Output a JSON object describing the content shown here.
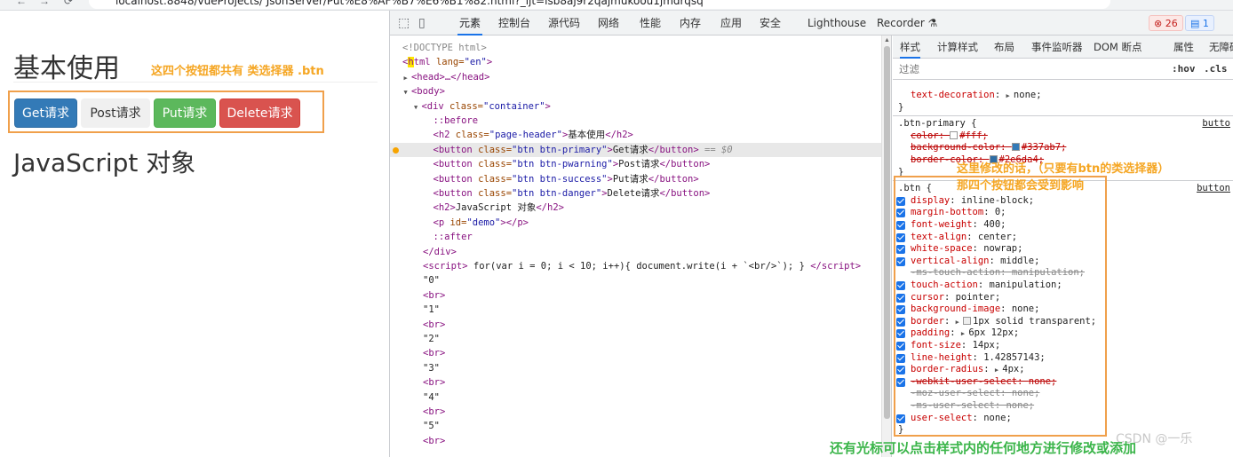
{
  "browser": {
    "url": "localhost:8848/vueProjects/ JsonServer/Put%E8%AF%B7%E6%B1%82.html?_ijt=lsb8aj9r2qajmukoou1jmdrqsq",
    "nav_back": "←",
    "nav_forward": "→",
    "nav_reload": "⟳"
  },
  "page": {
    "title": "基本使用",
    "buttons": [
      {
        "label": "Get请求",
        "class": "btn btn-primary"
      },
      {
        "label": "Post请求",
        "class": "btn btn-pwarning"
      },
      {
        "label": "Put请求",
        "class": "btn btn-success"
      },
      {
        "label": "Delete请求",
        "class": "btn btn-danger"
      }
    ],
    "js_title": "JavaScript 对象"
  },
  "devtools": {
    "tabs": [
      "元素",
      "控制台",
      "源代码",
      "网络",
      "性能",
      "内存",
      "应用",
      "安全",
      "Lighthouse",
      "Recorder ⚗"
    ],
    "active_tab": "元素",
    "error_count": "26",
    "message_count": "1",
    "elements": [
      {
        "indent": 0,
        "html": "<!DOCTYPE html>",
        "kind": "comment"
      },
      {
        "indent": 0,
        "tag": "html",
        "attrs": [
          [
            "lang",
            "en"
          ]
        ],
        "open": true
      },
      {
        "indent": 1,
        "collapsed": "<head>…</head>"
      },
      {
        "indent": 1,
        "tag": "body",
        "arrow": "▼"
      },
      {
        "indent": 2,
        "tag": "div",
        "attrs": [
          [
            "class",
            "container"
          ]
        ],
        "arrow": "▼"
      },
      {
        "indent": 3,
        "pseudo": "::before"
      },
      {
        "indent": 3,
        "tag": "h2",
        "attrs": [
          [
            "class",
            "page-header"
          ]
        ],
        "text": "基本使用",
        "close": "h2"
      },
      {
        "indent": 3,
        "tag": "button",
        "attrs": [
          [
            "class",
            "btn btn-primary"
          ]
        ],
        "text": "Get请求",
        "close": "button",
        "suffix": " == $0",
        "selected": true
      },
      {
        "indent": 3,
        "tag": "button",
        "attrs": [
          [
            "class",
            "btn btn-pwarning"
          ]
        ],
        "text": "Post请求",
        "close": "button"
      },
      {
        "indent": 3,
        "tag": "button",
        "attrs": [
          [
            "class",
            "btn btn-success"
          ]
        ],
        "text": "Put请求",
        "close": "button"
      },
      {
        "indent": 3,
        "tag": "button",
        "attrs": [
          [
            "class",
            "btn btn-danger"
          ]
        ],
        "text": "Delete请求",
        "close": "button"
      },
      {
        "indent": 3,
        "tag": "h2",
        "text": "JavaScript 对象",
        "close": "h2"
      },
      {
        "indent": 3,
        "tag": "p",
        "attrs": [
          [
            "id",
            "demo"
          ]
        ],
        "close": "p"
      },
      {
        "indent": 3,
        "pseudo": "::after"
      },
      {
        "indent": 2,
        "endtag": "div"
      },
      {
        "indent": 2,
        "tag": "script",
        "text": " for(var i = 0; i < 10; i++){ document.write(i + `<br/>`); } ",
        "close": "script"
      },
      {
        "indent": 2,
        "string": "\"0\""
      },
      {
        "indent": 2,
        "tag": "br"
      },
      {
        "indent": 2,
        "string": "\"1\""
      },
      {
        "indent": 2,
        "tag": "br"
      },
      {
        "indent": 2,
        "string": "\"2\""
      },
      {
        "indent": 2,
        "tag": "br"
      },
      {
        "indent": 2,
        "string": "\"3\""
      },
      {
        "indent": 2,
        "tag": "br"
      },
      {
        "indent": 2,
        "string": "\"4\""
      },
      {
        "indent": 2,
        "tag": "br"
      },
      {
        "indent": 2,
        "string": "\"5\""
      },
      {
        "indent": 2,
        "tag": "br"
      }
    ],
    "styles_tabs": [
      "样式",
      "计算样式",
      "布局",
      "事件监听器",
      "DOM 断点",
      "属性",
      "无障碍"
    ],
    "filter_placeholder": "过滤",
    "hov": ":hov",
    "cls": ".cls",
    "rules": {
      "top_line": {
        "name": "text-decoration",
        "value": "none;"
      },
      "btn_primary": {
        "selector": ".btn-primary {",
        "source": "butto",
        "props": [
          {
            "name": "color",
            "value": "#fff;",
            "swatch": "#ffffff"
          },
          {
            "name": "background-color",
            "value": "#337ab7;",
            "swatch": "#337ab7"
          },
          {
            "name": "border-color",
            "value": "#2e6da4;",
            "swatch": "#2e6da4"
          }
        ]
      },
      "btn": {
        "selector": ".btn {",
        "source": "button",
        "props": [
          {
            "name": "display",
            "value": "inline-block;",
            "checked": true
          },
          {
            "name": "margin-bottom",
            "value": "0;",
            "checked": true
          },
          {
            "name": "font-weight",
            "value": "400;",
            "checked": true
          },
          {
            "name": "text-align",
            "value": "center;",
            "checked": true
          },
          {
            "name": "white-space",
            "value": "nowrap;",
            "checked": true
          },
          {
            "name": "vertical-align",
            "value": "middle;",
            "checked": true
          },
          {
            "name": "-ms-touch-action",
            "value": "manipulation;",
            "checked": false,
            "strike": true
          },
          {
            "name": "touch-action",
            "value": "manipulation;",
            "checked": true
          },
          {
            "name": "cursor",
            "value": "pointer;",
            "checked": true
          },
          {
            "name": "background-image",
            "value": "none;",
            "checked": true
          },
          {
            "name": "border",
            "value": "1px solid transparent;",
            "checked": true,
            "arrow": true,
            "swatch": "#eeeeee"
          },
          {
            "name": "padding",
            "value": "6px 12px;",
            "checked": true,
            "arrow": true
          },
          {
            "name": "font-size",
            "value": "14px;",
            "checked": true
          },
          {
            "name": "line-height",
            "value": "1.42857143;",
            "checked": true
          },
          {
            "name": "border-radius",
            "value": "4px;",
            "checked": true,
            "arrow": true
          },
          {
            "name": "-webkit-user-select",
            "value": "none;",
            "checked": true,
            "strike_red": true
          },
          {
            "name": "-moz-user-select",
            "value": "none;",
            "checked": false,
            "strike": true
          },
          {
            "name": "-ms-user-select",
            "value": "none;",
            "checked": false,
            "strike": true
          },
          {
            "name": "user-select",
            "value": "none;",
            "checked": true
          }
        ]
      }
    }
  },
  "annotations": {
    "buttons_note": "这四个按钮都共有 类选择器 .btn",
    "modify_note_1": "这里修改的话，（只要有btn的类选择器）",
    "modify_note_2": "那四个按钮都会受到影响",
    "cursor_note": "还有光标可以点击样式内的任何地方进行修改或添加",
    "watermark": "CSDN @一乐"
  },
  "colors": {
    "annotation_orange": "#f0a04b",
    "annotation_green": "#3bb54a",
    "accent": "#1a73e8"
  }
}
